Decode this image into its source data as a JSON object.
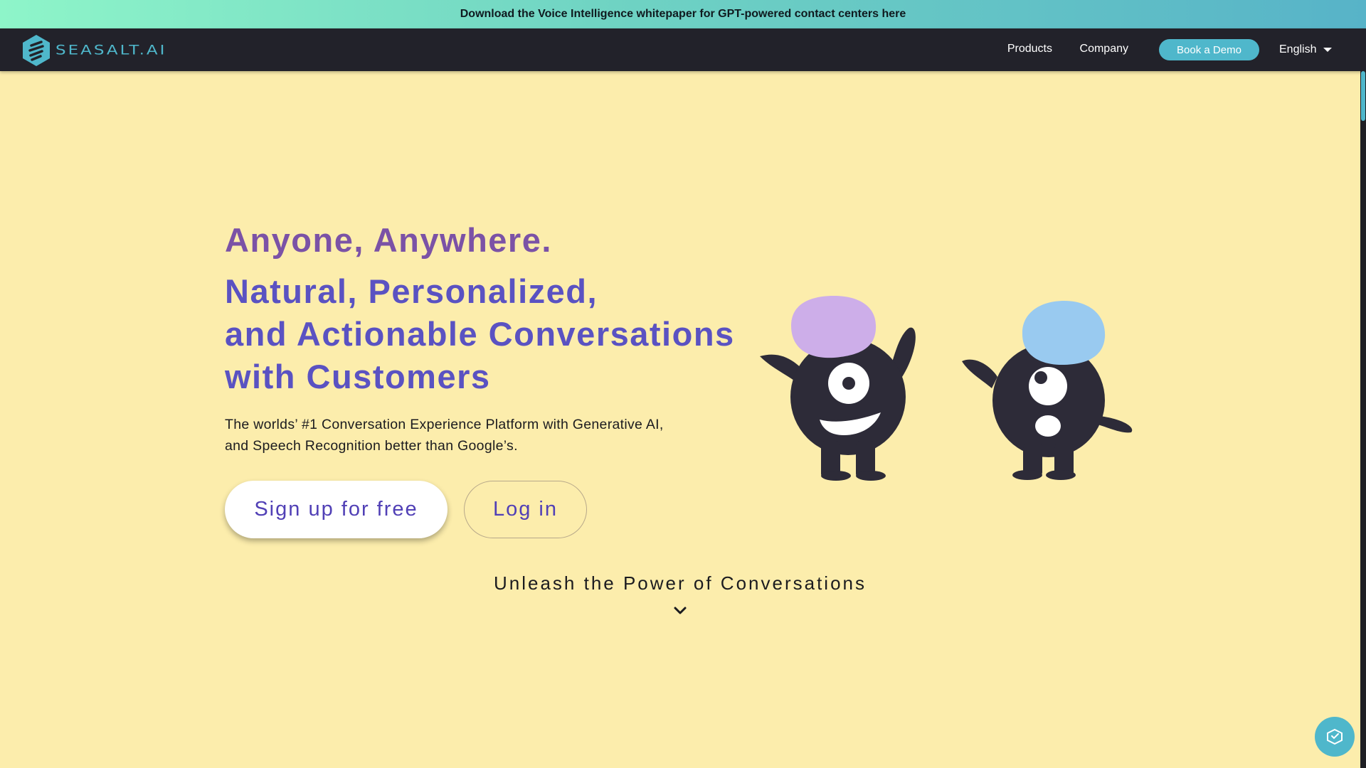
{
  "banner": {
    "text": "Download the Voice Intelligence whitepaper for GPT-powered contact centers here"
  },
  "nav": {
    "logo_text": "SEASALT.AI",
    "products": "Products",
    "company": "Company",
    "book_demo": "Book a Demo",
    "language": "English"
  },
  "hero": {
    "headline": "Anyone, Anywhere.",
    "subheadline_lines": [
      "Natural, Personalized,",
      "and Actionable Conversations",
      "with Customers"
    ],
    "description_lines": [
      "The worlds’ #1 Conversation Experience Platform with Generative AI,",
      "and Speech Recognition better than Google’s."
    ],
    "signup_label": "Sign up for free",
    "login_label": "Log in"
  },
  "section": {
    "power_title": "Unleash the Power of Conversations"
  },
  "icons": {
    "logo": "seasalt-logo-icon",
    "language_caret": "caret-down-icon",
    "scroll_down": "chevron-down-icon",
    "chat": "chat-widget-icon"
  },
  "colors": {
    "background": "#fcedac",
    "accent_teal": "#4fb7cb",
    "nav_bg": "#22222a",
    "headline_purple": "#7b52a6",
    "subheadline_indigo": "#5a52c2",
    "button_text": "#5140b6",
    "mascot_body": "#2d2b38",
    "mascot_hat_left": "#cdaee9",
    "mascot_hat_right": "#99caf0"
  }
}
